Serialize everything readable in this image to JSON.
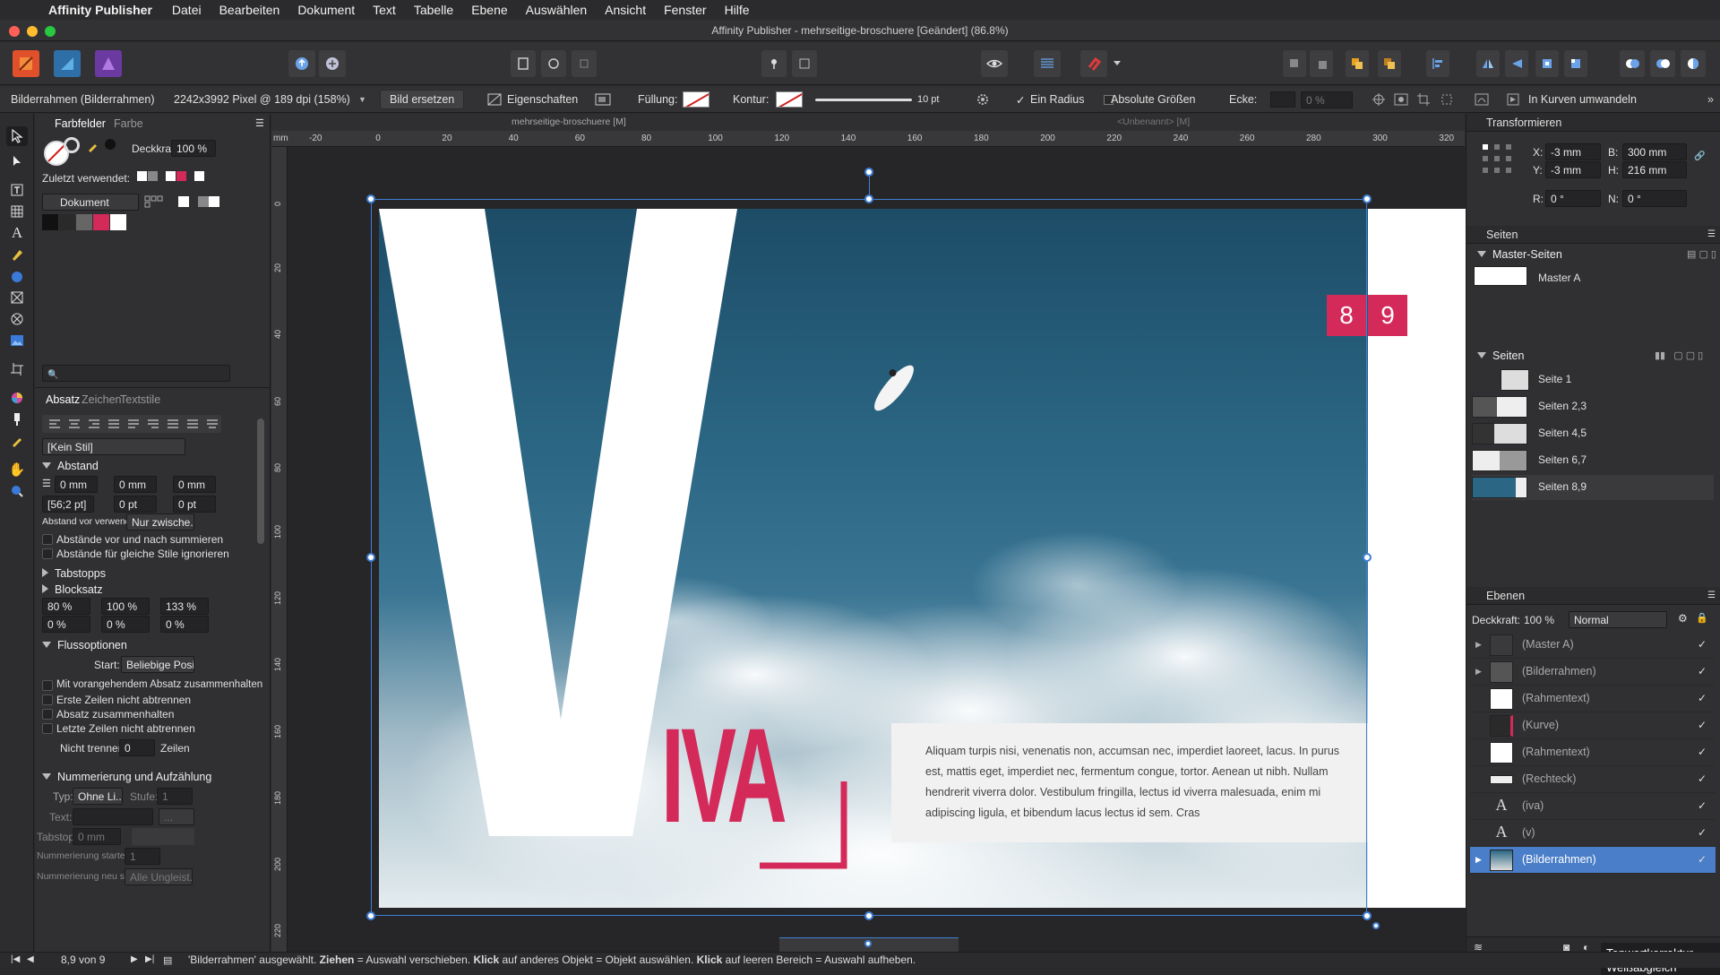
{
  "menubar": {
    "app_name": "Affinity Publisher",
    "items": [
      "Datei",
      "Bearbeiten",
      "Dokument",
      "Text",
      "Tabelle",
      "Ebene",
      "Auswählen",
      "Ansicht",
      "Fenster",
      "Hilfe"
    ]
  },
  "window": {
    "title": "Affinity Publisher - mehrseitige-broschuere [Geändert] (86.8%)"
  },
  "context": {
    "selection": "Bilderrahmen (Bilderrahmen)",
    "image_info": "2242x3992 Pixel @ 189 dpi (158%)",
    "replace_button": "Bild ersetzen",
    "properties_button": "Eigenschaften",
    "fill_label": "Füllung:",
    "stroke_label": "Kontur:",
    "stroke_width": "10 pt",
    "radius_label": "Ein Radius",
    "absolute_label": "Absolute Größen",
    "corner_label": "Ecke:",
    "corner_value": "0 %",
    "curves_button": "In Kurven umwandeln"
  },
  "doc_tabs": {
    "left": "mehrseitige-broschuere [M]",
    "right": "<Unbenannt> [M]"
  },
  "ruler": {
    "unit": "mm",
    "top_ticks": [
      "-20",
      "0",
      "20",
      "40",
      "60",
      "80",
      "100",
      "120",
      "140",
      "160",
      "180",
      "200",
      "220",
      "240",
      "260",
      "280",
      "300",
      "320"
    ],
    "left_ticks": [
      "0",
      "20",
      "40",
      "60",
      "80",
      "100",
      "120",
      "140",
      "160",
      "180",
      "200",
      "220"
    ]
  },
  "left_panel": {
    "tabs": [
      "Farbfelder",
      "Farbe"
    ],
    "opacity_label": "Deckkraft:",
    "opacity_value": "100 %",
    "recent_label": "Zuletzt verwendet:",
    "palette_dropdown": "Dokument",
    "para_tabs": [
      "Absatz",
      "Zeichen",
      "Textstile"
    ],
    "style_dropdown": "[Kein Stil]",
    "spacing": {
      "header": "Abstand",
      "left": "0 mm",
      "right": "0 mm",
      "first": "0 mm",
      "leading": "[56;2 pt]",
      "before": "0 pt",
      "after": "0 pt",
      "before_use_label": "Abstand vor verwenden:",
      "before_use_value": "Nur zwische...",
      "sum_label": "Abstände vor und nach summieren",
      "ignore_label": "Abstände für gleiche Stile ignorieren"
    },
    "tabstops_header": "Tabstopps",
    "justify": {
      "header": "Blocksatz",
      "v1": "80 %",
      "v2": "100 %",
      "v3": "133 %",
      "v4": "0 %",
      "v5": "0 %",
      "v6": "0 %"
    },
    "flow": {
      "header": "Flussoptionen",
      "start_label": "Start:",
      "start_value": "Beliebige Posi...",
      "opt1": "Mit vorangehendem Absatz zusammenhalten",
      "opt2": "Erste Zeilen nicht abtrennen",
      "opt3": "Absatz zusammenhalten",
      "opt4": "Letzte Zeilen nicht abtrennen",
      "nosplit_label": "Nicht trennen:",
      "nosplit_value": "0",
      "nosplit_unit": "Zeilen"
    },
    "numbering": {
      "header": "Nummerierung und Aufzählung",
      "type_label": "Typ:",
      "type_value": "Ohne Li...",
      "level_label": "Stufe:",
      "level_value": "1",
      "text_label": "Text:",
      "tab_label": "Tabstopp:",
      "tab_value": "0 mm",
      "start_label": "Nummerierung starten bei:",
      "start_value": "1",
      "restart_label": "Nummerierung neu starten:",
      "restart_value": "Alle Ungleist..."
    }
  },
  "canvas": {
    "page_numbers": [
      "8",
      "9"
    ],
    "title_big": "V",
    "title_small": "IVA",
    "body_text": "Aliquam turpis nisi, venenatis non, accumsan nec, imperdiet laoreet, lacus. In purus est, mattis eget, imperdiet nec, fermentum congue, tortor. Aenean ut nibh. Nullam hendrerit viverra dolor. Vestibulum fringilla, lectus id viverra malesuada, enim mi adipiscing ligula, et bibendum lacus lectus id sem. Cras",
    "accent_color": "#d42a5a"
  },
  "right_panel": {
    "transform": {
      "header": "Transformieren",
      "x_label": "X:",
      "x_value": "-3 mm",
      "y_label": "Y:",
      "y_value": "-3 mm",
      "b_label": "B:",
      "b_value": "300 mm",
      "h_label": "H:",
      "h_value": "216 mm",
      "r_label": "R:",
      "r_value": "0 °",
      "n_label": "N:",
      "n_value": "0 °"
    },
    "pages": {
      "header": "Seiten",
      "master_header": "Master-Seiten",
      "master_item": "Master A",
      "pages_header": "Seiten",
      "items": [
        "Seite 1",
        "Seiten 2,3",
        "Seiten 4,5",
        "Seiten 6,7",
        "Seiten 8,9"
      ]
    },
    "layers": {
      "header": "Ebenen",
      "opacity_label": "Deckkraft:",
      "opacity_value": "100 %",
      "blend": "Normal",
      "items": [
        "(Master A)",
        "(Bilderrahmen)",
        "(Rahmentext)",
        "(Kurve)",
        "(Rahmentext)",
        "(Rechteck)",
        "(iva)",
        "(v)",
        "(Bilderrahmen)"
      ]
    },
    "tooltip_line1": "Tonwertkorrektur...",
    "tooltip_line2": "Weißabgleich"
  },
  "status": {
    "page": "8,9 von 9",
    "msg_pre": "'Bilderrahmen' ausgewählt.",
    "drag_b": "Ziehen",
    "drag_t": "= Auswahl verschieben.",
    "click_b": "Klick",
    "click_t": "auf anderes Objekt = Objekt auswählen.",
    "click2_b": "Klick",
    "click2_t": "auf leeren Bereich = Auswahl aufheben."
  }
}
